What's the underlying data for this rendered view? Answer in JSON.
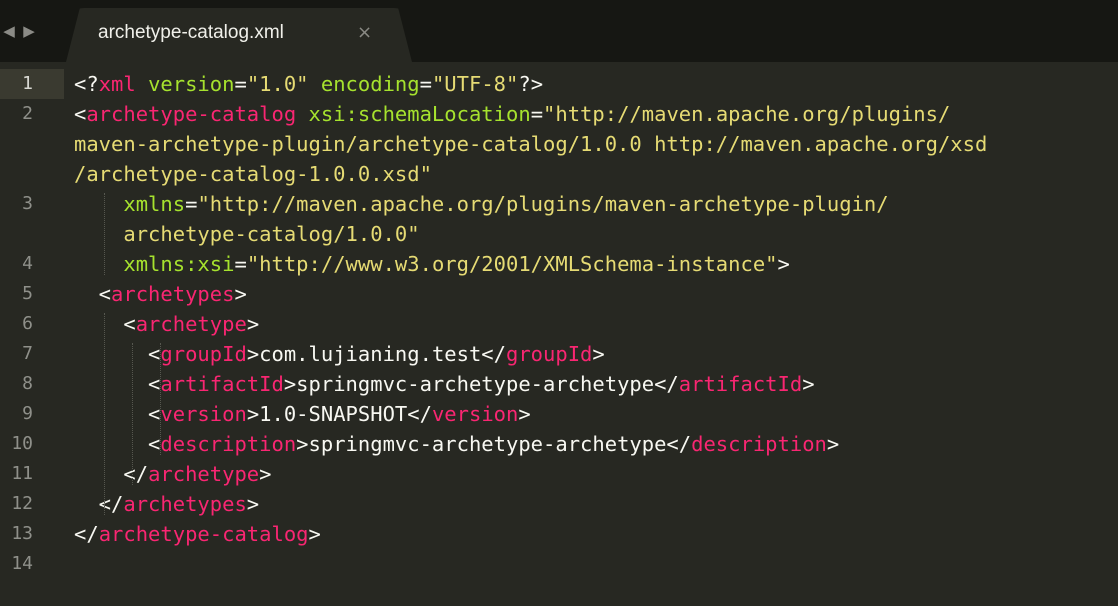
{
  "tab": {
    "title": "archetype-catalog.xml",
    "close_glyph": "×",
    "back_glyph": "◀",
    "forward_glyph": "▶"
  },
  "colors": {
    "background": "#272822",
    "tag": "#f92672",
    "attribute": "#a6e22e",
    "string": "#e6db74",
    "text": "#f8f8f2",
    "line_number": "#8f908a"
  },
  "editor": {
    "line_numbers": [
      "1",
      "2",
      "3",
      "4",
      "5",
      "6",
      "7",
      "8",
      "9",
      "10",
      "11",
      "12",
      "13",
      "14"
    ],
    "rows": [
      [
        {
          "t": "<?",
          "c": "punc"
        },
        {
          "t": "xml",
          "c": "tag"
        },
        {
          "t": " "
        },
        {
          "t": "version",
          "c": "attr"
        },
        {
          "t": "="
        },
        {
          "t": "\"1.0\"",
          "c": "str"
        },
        {
          "t": " "
        },
        {
          "t": "encoding",
          "c": "attr"
        },
        {
          "t": "="
        },
        {
          "t": "\"UTF-8\"",
          "c": "str"
        },
        {
          "t": "?>"
        }
      ],
      [
        {
          "t": "<"
        },
        {
          "t": "archetype-catalog",
          "c": "tag"
        },
        {
          "t": " "
        },
        {
          "t": "xsi:schemaLocation",
          "c": "attr"
        },
        {
          "t": "="
        },
        {
          "t": "\"http://maven.apache.org/plugins/",
          "c": "str"
        }
      ],
      [
        {
          "t": "maven-archetype-plugin/archetype-catalog/1.0.0 http://maven.apache.org/xsd",
          "c": "str"
        }
      ],
      [
        {
          "t": "/archetype-catalog-1.0.0.xsd\"",
          "c": "str"
        }
      ],
      [
        {
          "t": "    "
        },
        {
          "t": "xmlns",
          "c": "attr"
        },
        {
          "t": "="
        },
        {
          "t": "\"http://maven.apache.org/plugins/maven-archetype-plugin/",
          "c": "str"
        }
      ],
      [
        {
          "t": "    "
        },
        {
          "t": "archetype-catalog/1.0.0\"",
          "c": "str"
        }
      ],
      [
        {
          "t": "    "
        },
        {
          "t": "xmlns:xsi",
          "c": "attr"
        },
        {
          "t": "="
        },
        {
          "t": "\"http://www.w3.org/2001/XMLSchema-instance\"",
          "c": "str"
        },
        {
          "t": ">"
        }
      ],
      [
        {
          "t": "  <"
        },
        {
          "t": "archetypes",
          "c": "tag"
        },
        {
          "t": ">"
        }
      ],
      [
        {
          "t": "    <"
        },
        {
          "t": "archetype",
          "c": "tag"
        },
        {
          "t": ">"
        }
      ],
      [
        {
          "t": "      <"
        },
        {
          "t": "groupId",
          "c": "tag"
        },
        {
          "t": ">com.lujianing.test</"
        },
        {
          "t": "groupId",
          "c": "tag"
        },
        {
          "t": ">"
        }
      ],
      [
        {
          "t": "      <"
        },
        {
          "t": "artifactId",
          "c": "tag"
        },
        {
          "t": ">springmvc-archetype-archetype</"
        },
        {
          "t": "artifactId",
          "c": "tag"
        },
        {
          "t": ">"
        }
      ],
      [
        {
          "t": "      <"
        },
        {
          "t": "version",
          "c": "tag"
        },
        {
          "t": ">1.0-SNAPSHOT</"
        },
        {
          "t": "version",
          "c": "tag"
        },
        {
          "t": ">"
        }
      ],
      [
        {
          "t": "      <"
        },
        {
          "t": "description",
          "c": "tag"
        },
        {
          "t": ">springmvc-archetype-archetype</"
        },
        {
          "t": "description",
          "c": "tag"
        },
        {
          "t": ">"
        }
      ],
      [
        {
          "t": "    </"
        },
        {
          "t": "archetype",
          "c": "tag"
        },
        {
          "t": ">"
        }
      ],
      [
        {
          "t": "  </"
        },
        {
          "t": "archetypes",
          "c": "tag"
        },
        {
          "t": ">"
        }
      ],
      [
        {
          "t": "</"
        },
        {
          "t": "archetype-catalog",
          "c": "tag"
        },
        {
          "t": ">"
        }
      ],
      []
    ],
    "row_line_number_index": [
      0,
      1,
      -1,
      -1,
      2,
      -1,
      3,
      4,
      5,
      6,
      7,
      8,
      9,
      10,
      11,
      12,
      13
    ]
  }
}
